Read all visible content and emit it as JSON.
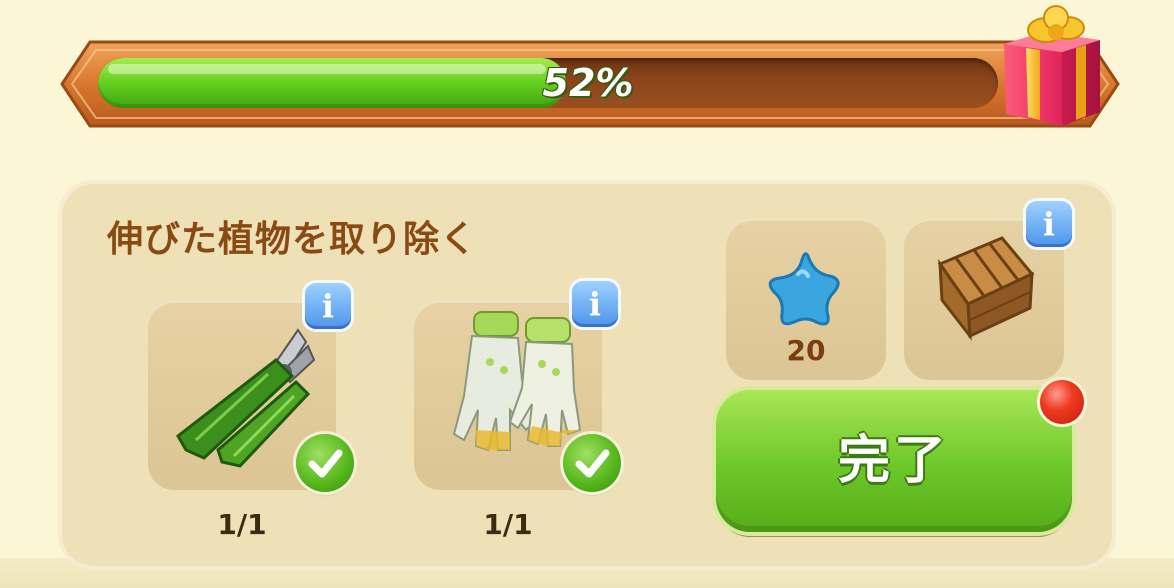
{
  "progress": {
    "percent_label": "52%",
    "value": 0.52
  },
  "task": {
    "title": "伸びた植物を取り除く",
    "items": [
      {
        "icon": "pruning-shears-icon",
        "count_label": "1/1",
        "completed": true
      },
      {
        "icon": "garden-gloves-icon",
        "count_label": "1/1",
        "completed": true
      }
    ]
  },
  "rewards": [
    {
      "icon": "blue-star-icon",
      "amount": "20"
    },
    {
      "icon": "wooden-crate-icon"
    }
  ],
  "info_label": "i",
  "complete_button": {
    "label": "完了"
  },
  "colors": {
    "progress_fill": "#5fcb1c",
    "progress_track": "#8a4419",
    "title_text": "#8a4a14",
    "button_green": "#6cc72a",
    "info_blue": "#4c94ea",
    "notification_red": "#f03a22"
  }
}
